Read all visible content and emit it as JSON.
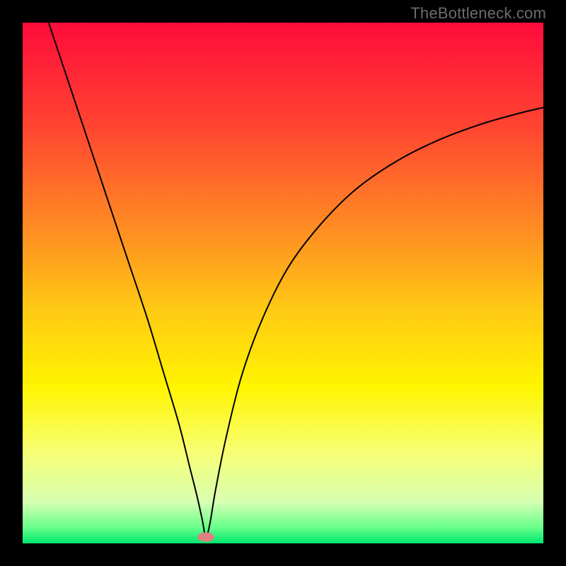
{
  "watermark": "TheBottleneck.com",
  "chart_data": {
    "type": "line",
    "title": "",
    "xlabel": "",
    "ylabel": "",
    "xlim": [
      0,
      100
    ],
    "ylim": [
      0,
      100
    ],
    "grid": false,
    "legend": false,
    "annotations": [],
    "gradient_stops": [
      {
        "pos": 0.0,
        "color": "#ff0b3b"
      },
      {
        "pos": 0.2,
        "color": "#ff4531"
      },
      {
        "pos": 0.4,
        "color": "#ff8e22"
      },
      {
        "pos": 0.55,
        "color": "#ffc914"
      },
      {
        "pos": 0.7,
        "color": "#fff500"
      },
      {
        "pos": 0.82,
        "color": "#f8ff70"
      },
      {
        "pos": 0.92,
        "color": "#d7ffb2"
      },
      {
        "pos": 0.97,
        "color": "#66ff8a"
      },
      {
        "pos": 1.0,
        "color": "#00e66e"
      }
    ],
    "series": [
      {
        "name": "bottleneck-curve",
        "color": "#000000",
        "width": 2,
        "x": [
          5,
          8,
          12,
          16,
          20,
          24,
          27,
          30,
          32,
          33.5,
          34.5,
          35.2,
          36,
          37,
          39,
          42,
          46,
          51,
          57,
          64,
          72,
          80,
          88,
          95,
          100
        ],
        "y": [
          100,
          91,
          79,
          67,
          55,
          43,
          33,
          23,
          15,
          9,
          4.5,
          1.2,
          4,
          10,
          20,
          32,
          43,
          53,
          61,
          68,
          73.5,
          77.5,
          80.5,
          82.5,
          83.7
        ]
      }
    ],
    "marker": {
      "name": "optimal-point",
      "x": 35.2,
      "y": 1.2,
      "rx": 1.6,
      "ry": 0.9,
      "fill": "#e08080"
    }
  }
}
